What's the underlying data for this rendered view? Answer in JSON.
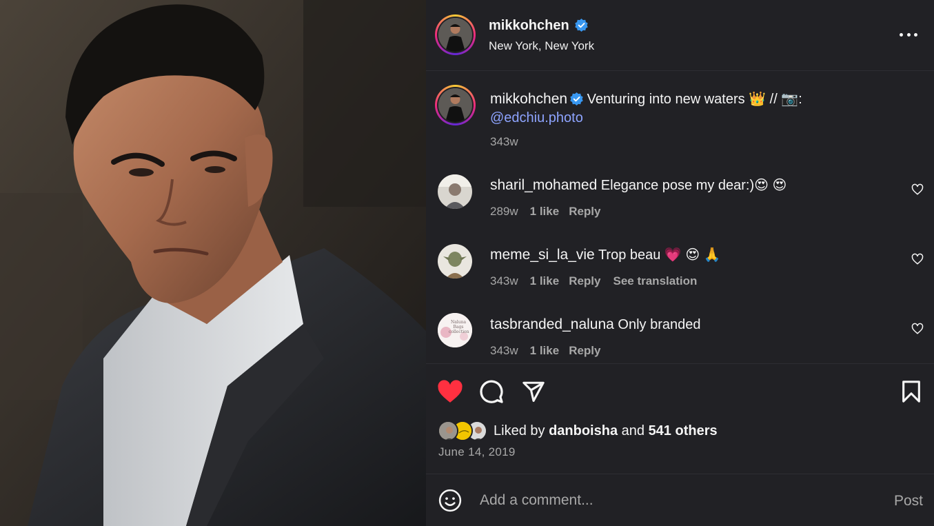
{
  "post": {
    "username": "mikkohchen",
    "location": "New York, New York",
    "more_icon": "more-horizontal-icon",
    "verified_color": "#3897f0"
  },
  "caption": {
    "username": "mikkohchen",
    "text": " Venturing into new waters ",
    "emoji_crown": "👑",
    "separator": " // ",
    "emoji_camera": "📷",
    "colon": ":",
    "mention": "@edchiu.photo",
    "time": "343w"
  },
  "comments": [
    {
      "username": "sharil_mohamed",
      "text": " Elegance pose my dear:)😍 😍",
      "time": "289w",
      "likes": "1 like",
      "reply": "Reply"
    },
    {
      "username": "meme_si_la_vie",
      "text": " Trop beau 💗 😍 🙏",
      "time": "343w",
      "likes": "1 like",
      "reply": "Reply",
      "translate": "See translation"
    },
    {
      "username": "tasbranded_naluna",
      "text": " Only branded",
      "time": "343w",
      "likes": "1 like",
      "reply": "Reply",
      "avatar_text": "Naluna Bags collection"
    }
  ],
  "actions": {
    "like_color": "#ff3040",
    "liked_prefix": "Liked by ",
    "liked_user": "danboisha",
    "liked_mid": " and ",
    "liked_others": "541 others",
    "date": "June 14, 2019"
  },
  "composer": {
    "placeholder": "Add a comment...",
    "post_label": "Post"
  }
}
